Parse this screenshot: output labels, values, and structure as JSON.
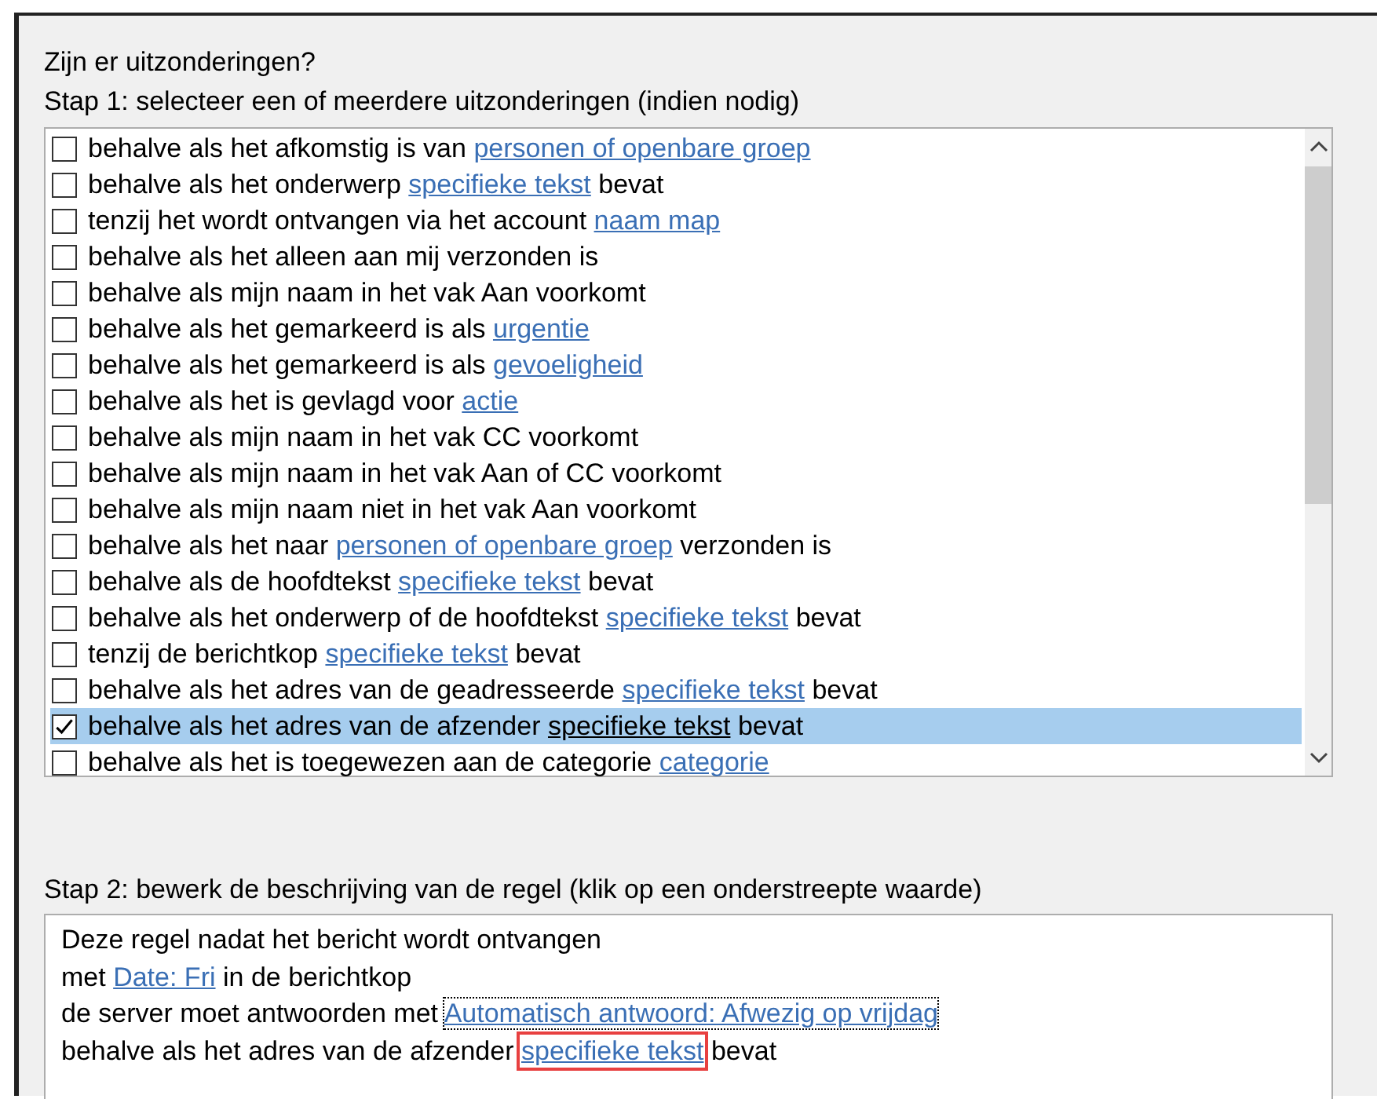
{
  "heading": "Zijn er uitzonderingen?",
  "step1": {
    "label": "Stap 1: selecteer een of meerdere uitzonderingen (indien nodig)",
    "items": [
      {
        "checked": false,
        "selected": false,
        "parts": [
          {
            "text": "behalve als het afkomstig is van",
            "link": false
          },
          {
            "text": "personen of openbare groep",
            "link": true
          }
        ]
      },
      {
        "checked": false,
        "selected": false,
        "parts": [
          {
            "text": "behalve als het onderwerp",
            "link": false
          },
          {
            "text": "specifieke tekst",
            "link": true
          },
          {
            "text": "bevat",
            "link": false
          }
        ]
      },
      {
        "checked": false,
        "selected": false,
        "parts": [
          {
            "text": "tenzij het wordt ontvangen via het account",
            "link": false
          },
          {
            "text": "naam map",
            "link": true
          }
        ]
      },
      {
        "checked": false,
        "selected": false,
        "parts": [
          {
            "text": "behalve als het alleen aan mij verzonden is",
            "link": false
          }
        ]
      },
      {
        "checked": false,
        "selected": false,
        "parts": [
          {
            "text": "behalve als mijn naam in het vak Aan voorkomt",
            "link": false
          }
        ]
      },
      {
        "checked": false,
        "selected": false,
        "parts": [
          {
            "text": "behalve als het gemarkeerd is als",
            "link": false
          },
          {
            "text": "urgentie",
            "link": true
          }
        ]
      },
      {
        "checked": false,
        "selected": false,
        "parts": [
          {
            "text": "behalve als het gemarkeerd is als",
            "link": false
          },
          {
            "text": "gevoeligheid",
            "link": true
          }
        ]
      },
      {
        "checked": false,
        "selected": false,
        "parts": [
          {
            "text": "behalve als het is gevlagd voor",
            "link": false
          },
          {
            "text": "actie",
            "link": true
          }
        ]
      },
      {
        "checked": false,
        "selected": false,
        "parts": [
          {
            "text": "behalve als mijn naam in het vak CC voorkomt",
            "link": false
          }
        ]
      },
      {
        "checked": false,
        "selected": false,
        "parts": [
          {
            "text": "behalve als mijn naam in het vak Aan of CC voorkomt",
            "link": false
          }
        ]
      },
      {
        "checked": false,
        "selected": false,
        "parts": [
          {
            "text": "behalve als mijn naam niet in het vak Aan voorkomt",
            "link": false
          }
        ]
      },
      {
        "checked": false,
        "selected": false,
        "parts": [
          {
            "text": "behalve als het naar",
            "link": false
          },
          {
            "text": "personen of openbare groep",
            "link": true
          },
          {
            "text": "verzonden is",
            "link": false
          }
        ]
      },
      {
        "checked": false,
        "selected": false,
        "parts": [
          {
            "text": "behalve als de hoofdtekst",
            "link": false
          },
          {
            "text": "specifieke tekst",
            "link": true
          },
          {
            "text": "bevat",
            "link": false
          }
        ]
      },
      {
        "checked": false,
        "selected": false,
        "parts": [
          {
            "text": "behalve als het onderwerp of de hoofdtekst",
            "link": false
          },
          {
            "text": "specifieke tekst",
            "link": true
          },
          {
            "text": "bevat",
            "link": false
          }
        ]
      },
      {
        "checked": false,
        "selected": false,
        "parts": [
          {
            "text": "tenzij de berichtkop",
            "link": false
          },
          {
            "text": "specifieke tekst",
            "link": true
          },
          {
            "text": "bevat",
            "link": false
          }
        ]
      },
      {
        "checked": false,
        "selected": false,
        "parts": [
          {
            "text": "behalve als het adres van de geadresseerde",
            "link": false
          },
          {
            "text": "specifieke tekst",
            "link": true
          },
          {
            "text": "bevat",
            "link": false
          }
        ]
      },
      {
        "checked": true,
        "selected": true,
        "parts": [
          {
            "text": "behalve als het adres van de afzender",
            "link": false
          },
          {
            "text": "specifieke tekst",
            "link": true
          },
          {
            "text": "bevat",
            "link": false
          }
        ]
      },
      {
        "checked": false,
        "selected": false,
        "parts": [
          {
            "text": "behalve als het is toegewezen aan de categorie",
            "link": false
          },
          {
            "text": "categorie",
            "link": true
          }
        ]
      }
    ]
  },
  "step2": {
    "label": "Stap 2: bewerk de beschrijving van de regel (klik op een onderstreepte waarde)",
    "lines": [
      {
        "parts": [
          {
            "text": "Deze regel nadat het bericht wordt ontvangen",
            "link": false
          }
        ]
      },
      {
        "parts": [
          {
            "text": "met",
            "link": false
          },
          {
            "text": "Date: Fri",
            "link": true
          },
          {
            "text": "in de berichtkop",
            "link": false
          }
        ]
      },
      {
        "parts": [
          {
            "text": "de server moet antwoorden met",
            "link": false
          },
          {
            "text": "Automatisch antwoord: Afwezig op vrijdag",
            "link": true,
            "focused": true
          }
        ]
      },
      {
        "parts": [
          {
            "text": "behalve als het adres van de afzender",
            "link": false
          },
          {
            "text": "specifieke tekst",
            "link": true,
            "highlighted": true
          },
          {
            "text": "bevat",
            "link": false
          }
        ]
      }
    ]
  }
}
